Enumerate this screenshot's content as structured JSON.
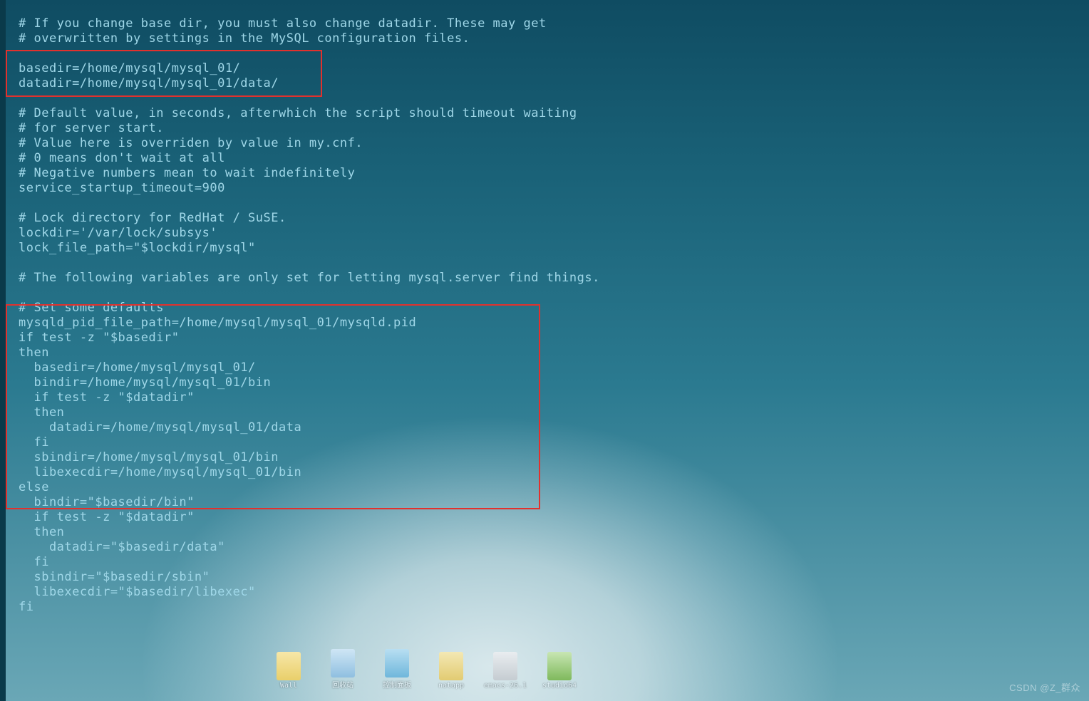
{
  "code_lines": [
    "",
    "# If you change base dir, you must also change datadir. These may get",
    "# overwritten by settings in the MySQL configuration files.",
    "",
    "basedir=/home/mysql/mysql_01/",
    "datadir=/home/mysql/mysql_01/data/",
    "",
    "# Default value, in seconds, afterwhich the script should timeout waiting",
    "# for server start.",
    "# Value here is overriden by value in my.cnf.",
    "# 0 means don't wait at all",
    "# Negative numbers mean to wait indefinitely",
    "service_startup_timeout=900",
    "",
    "# Lock directory for RedHat / SuSE.",
    "lockdir='/var/lock/subsys'",
    "lock_file_path=\"$lockdir/mysql\"",
    "",
    "# The following variables are only set for letting mysql.server find things.",
    "",
    "# Set some defaults",
    "mysqld_pid_file_path=/home/mysql/mysql_01/mysqld.pid",
    "if test -z \"$basedir\"",
    "then",
    "  basedir=/home/mysql/mysql_01/",
    "  bindir=/home/mysql/mysql_01/bin",
    "  if test -z \"$datadir\"",
    "  then",
    "    datadir=/home/mysql/mysql_01/data",
    "  fi",
    "  sbindir=/home/mysql/mysql_01/bin",
    "  libexecdir=/home/mysql/mysql_01/bin",
    "else",
    "  bindir=\"$basedir/bin\"",
    "  if test -z \"$datadir\"",
    "  then",
    "    datadir=\"$basedir/data\"",
    "  fi",
    "  sbindir=\"$basedir/sbin\"",
    "  libexecdir=\"$basedir/libexec\"",
    "fi"
  ],
  "taskbar": [
    {
      "id": "wall",
      "label": "Wall"
    },
    {
      "id": "recycle",
      "label": "回收站"
    },
    {
      "id": "control",
      "label": "控制面板"
    },
    {
      "id": "natapp",
      "label": "natapp"
    },
    {
      "id": "emacs",
      "label": "emacs-26.1"
    },
    {
      "id": "studio64",
      "label": "studio64"
    }
  ],
  "watermark": "CSDN @Z_群众"
}
